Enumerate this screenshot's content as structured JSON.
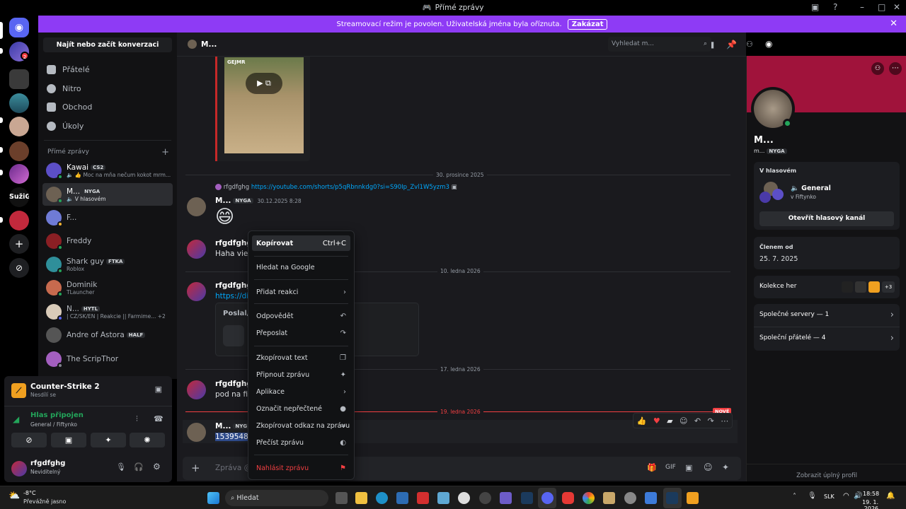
{
  "window": {
    "title": "Přímé zprávy"
  },
  "banner": {
    "text": "Streamovací režim je povolen. Uživatelská jména byla oříznuta.",
    "button": "Zakázat",
    "close": "✕"
  },
  "rail": {
    "servers_badge": "2",
    "server_label": "SužiG"
  },
  "dm_sidebar": {
    "search": "Najít nebo začít konverzaci",
    "nav": [
      "Přátelé",
      "Nitro",
      "Obchod",
      "Úkoly"
    ],
    "header": "Přímé zprávy",
    "dms": [
      {
        "name": "Kawai",
        "tag": "CS2",
        "sub": "🔈 👍 Moc na mňa nečum kokot mrm..."
      },
      {
        "name": "M...",
        "tag": "NYGA",
        "sub": "🔈 V hlasovém"
      },
      {
        "name": "F...",
        "tag": "",
        "sub": ""
      },
      {
        "name": "Freddy",
        "tag": "",
        "sub": ""
      },
      {
        "name": "Shark guy",
        "tag": "FTKA",
        "sub": "Roblox"
      },
      {
        "name": "Dominik",
        "tag": "",
        "sub": "TLauncher"
      },
      {
        "name": "N...",
        "tag": "HYTL",
        "sub": "| CZ/SK/EN | Reakcie || Farmime...  +2"
      },
      {
        "name": "Andre of Astora",
        "tag": "HALF",
        "sub": ""
      },
      {
        "name": "The ScripThor",
        "tag": "",
        "sub": ""
      }
    ]
  },
  "panel": {
    "game": "Counter-Strike 2",
    "game_sub": "Nesdílí se",
    "voice": "Hlas připojen",
    "voice_sub": "General / Fiftynko",
    "user": "rfgdfghg",
    "status": "Neviditelný"
  },
  "chat": {
    "header_name": "M...",
    "search_placeholder": "Vyhledat m...",
    "video_label": "GEJMR",
    "sep1": "30. prosince 2025",
    "reply_user": "rfgdfghg",
    "reply_link": "https://youtube.com/shorts/p5qRbnnkdg0?si=S90Ip_Zvl1W5yzm3",
    "m1_name": "M...",
    "m1_tag": "NYGA",
    "m1_time": "30.12.2025 8:28",
    "m1_emoji": "😄",
    "m2_name": "rfgdfghg",
    "m2_text": "Haha viem",
    "sep2": "10. ledna 2026",
    "m3_name": "rfgdfghg",
    "m3_link": "https://dis",
    "m3_embed": "Poslal/a",
    "sep3": "17. ledna 2026",
    "m4_name": "rfgdfghg",
    "m4_text": "pod na fift",
    "sep4": "19. ledna 2026",
    "new_label": "NOVÉ",
    "m5_name": "M...",
    "m5_tag": "NYG",
    "m5_text": "153954881",
    "input_placeholder": "Zpráva @M"
  },
  "context_menu": {
    "copy": "Kopírovat",
    "copy_shortcut": "Ctrl+C",
    "google": "Hledat na Google",
    "react": "Přidat reakci",
    "reply": "Odpovědět",
    "forward": "Přeposlat",
    "copy_text": "Zkopírovat text",
    "pin": "Připnout zprávu",
    "apps": "Aplikace",
    "unread": "Označit nepřečtené",
    "copy_link": "Zkopírovat odkaz na zprávu",
    "read": "Přečíst zprávu",
    "report": "Nahlásit zprávu"
  },
  "profile": {
    "name": "M...",
    "handle": "m...",
    "tag": "NYGA",
    "voice_title": "V hlasovém",
    "channel": "General",
    "server": "v Fiftynko",
    "open_voice": "Otevřít hlasový kanál",
    "member_title": "Členem od",
    "member_date": "25. 7. 2025",
    "collection": "Kolekce her",
    "collection_more": "+3",
    "servers": "Společné servery — 1",
    "friends": "Společní přátelé — 4",
    "full": "Zobrazit úplný profil"
  },
  "taskbar": {
    "temp": "-8°C",
    "weather": "Převážně jasno",
    "search": "Hledat",
    "lang": "SLK",
    "time": "18:58",
    "date": "19. 1. 2026"
  },
  "colors": {
    "accent": "#5865f2",
    "banner": "#8e3bf5",
    "danger": "#f23f42",
    "online": "#23a55a",
    "profile_banner": "#a0133b"
  }
}
